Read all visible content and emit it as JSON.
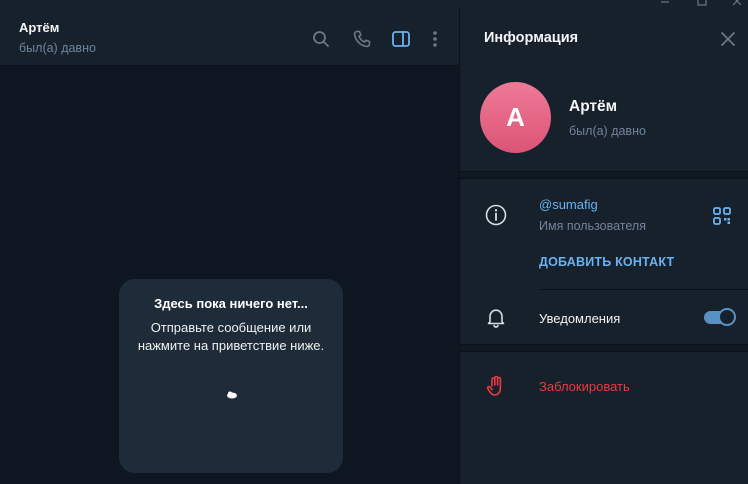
{
  "chat": {
    "name": "Артём",
    "status": "был(а) давно",
    "header_icons": [
      "search-icon",
      "phone-icon",
      "sidebar-toggle-icon",
      "more-icon"
    ],
    "empty_state": {
      "title": "Здесь пока ничего нет...",
      "line1": "Отправьте сообщение или",
      "line2": "нажмите на приветствие ниже."
    }
  },
  "info_panel": {
    "title": "Информация",
    "avatar_letter": "А",
    "name": "Артём",
    "status": "был(а) давно",
    "username": "@sumafig",
    "username_caption": "Имя пользователя",
    "add_contact": "ДОБАВИТЬ КОНТАКТ",
    "notifications_label": "Уведомления",
    "notifications_enabled": true,
    "block_label": "Заблокировать"
  },
  "colors": {
    "accent": "#6ab2f2",
    "danger": "#ec3942",
    "avatar_top": "#ee7a97",
    "avatar_bottom": "#dc5476",
    "panel_bg": "#17212b",
    "chat_bg": "#0e1621"
  }
}
